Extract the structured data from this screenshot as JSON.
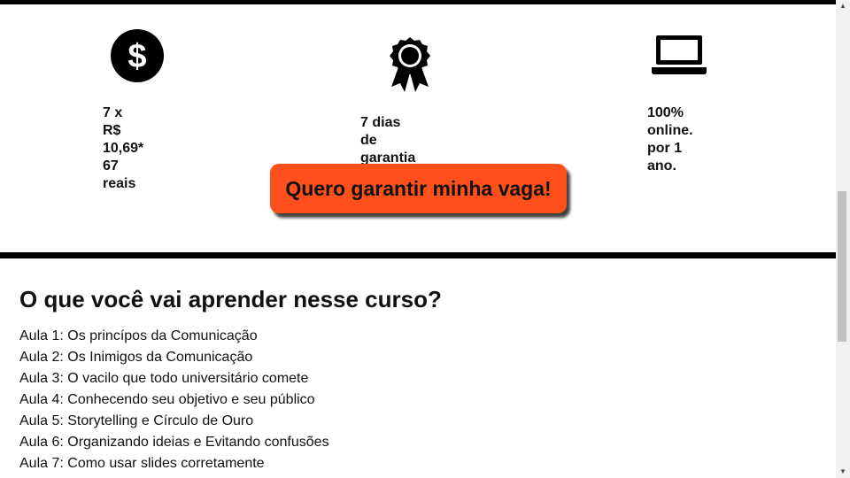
{
  "features": {
    "price": {
      "icon": "dollar-circle-icon",
      "line1": "7 x R$ 10,69*",
      "line2": "67 reais"
    },
    "guarantee": {
      "icon": "award-ribbon-icon",
      "text": "7 dias de garantia"
    },
    "online": {
      "icon": "laptop-icon",
      "line1": "100% online.",
      "line2": "por 1 ano."
    }
  },
  "cta": {
    "label": "Quero garantir minha vaga!",
    "color": "#ff4f1a"
  },
  "course": {
    "title": "O que você vai aprender nesse curso?",
    "lessons": [
      "Aula 1: Os princípos da Comunicação",
      "Aula 2: Os Inimigos da Comunicação",
      "Aula 3: O vacilo que todo universitário comete",
      "Aula 4: Conhecendo seu objetivo e seu público",
      "Aula 5: Storytelling e Círculo de Ouro",
      "Aula 6: Organizando ideias e Evitando confusões",
      "Aula 7: Como usar slides corretamente"
    ]
  },
  "scrollbar": {
    "up_icon": "scroll-up-arrow-icon",
    "down_icon": "scroll-down-arrow-icon"
  }
}
